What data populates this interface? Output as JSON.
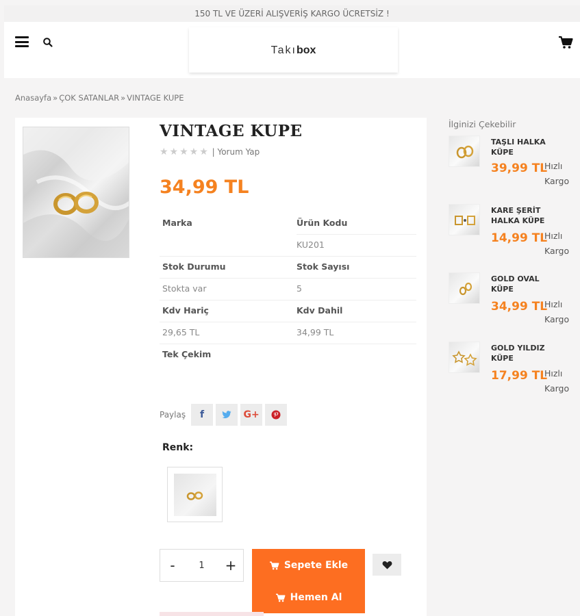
{
  "topbar": {
    "text": "150 TL VE ÜZERİ ALIŞVERİŞ KARGO ÜCRETSİZ !"
  },
  "header": {
    "logo_part1": "Takı",
    "logo_part2": "box"
  },
  "breadcrumb": {
    "home": "Anasayfa",
    "sep": "»",
    "category": "ÇOK SATANLAR",
    "current": "VINTAGE KUPE"
  },
  "product": {
    "title": "VINTAGE KUPE",
    "stars": "★★★★★",
    "review_link": "| Yorum Yap",
    "price": "34,99 TL"
  },
  "info": {
    "brand_label": "Marka",
    "brand_value": "",
    "code_label": "Ürün Kodu",
    "code_value": "KU201",
    "stock_status_label": "Stok Durumu",
    "stock_status_value": "Stokta var",
    "stock_count_label": "Stok Sayısı",
    "stock_count_value": "5",
    "excl_vat_label": "Kdv Hariç",
    "excl_vat_value": "29,65 TL",
    "incl_vat_label": "Kdv Dahil",
    "incl_vat_value": "34,99 TL",
    "single_payment_label": "Tek Çekim"
  },
  "share": {
    "label": "Paylaş",
    "facebook": "f",
    "twitter": "t",
    "google": "G+",
    "pinterest": "p"
  },
  "variants": {
    "label": "Renk:"
  },
  "actions": {
    "qty_minus": "-",
    "qty_value": "1",
    "qty_plus": "+",
    "add_to_cart": "Sepete Ekle",
    "buy_now": "Hemen Al"
  },
  "sidebar": {
    "title": "İlginizi Çekebilir",
    "items": [
      {
        "name": "TAŞLI HALKA KÜPE",
        "price": "39,99 TL",
        "shipping_line1": "Hızlı",
        "shipping_line2": "Kargo"
      },
      {
        "name": "KARE ŞERİT HALKA KÜPE",
        "price": "14,99 TL",
        "shipping_line1": "Hızlı",
        "shipping_line2": "Kargo"
      },
      {
        "name": "GOLD OVAL KÜPE",
        "price": "34,99 TL",
        "shipping_line1": "Hızlı",
        "shipping_line2": "Kargo"
      },
      {
        "name": "GOLD YILDIZ KÜPE",
        "price": "17,99 TL",
        "shipping_line1": "Hızlı",
        "shipping_line2": "Kargo"
      }
    ]
  },
  "colors": {
    "accent": "#f58220",
    "button": "#fd6e21"
  }
}
